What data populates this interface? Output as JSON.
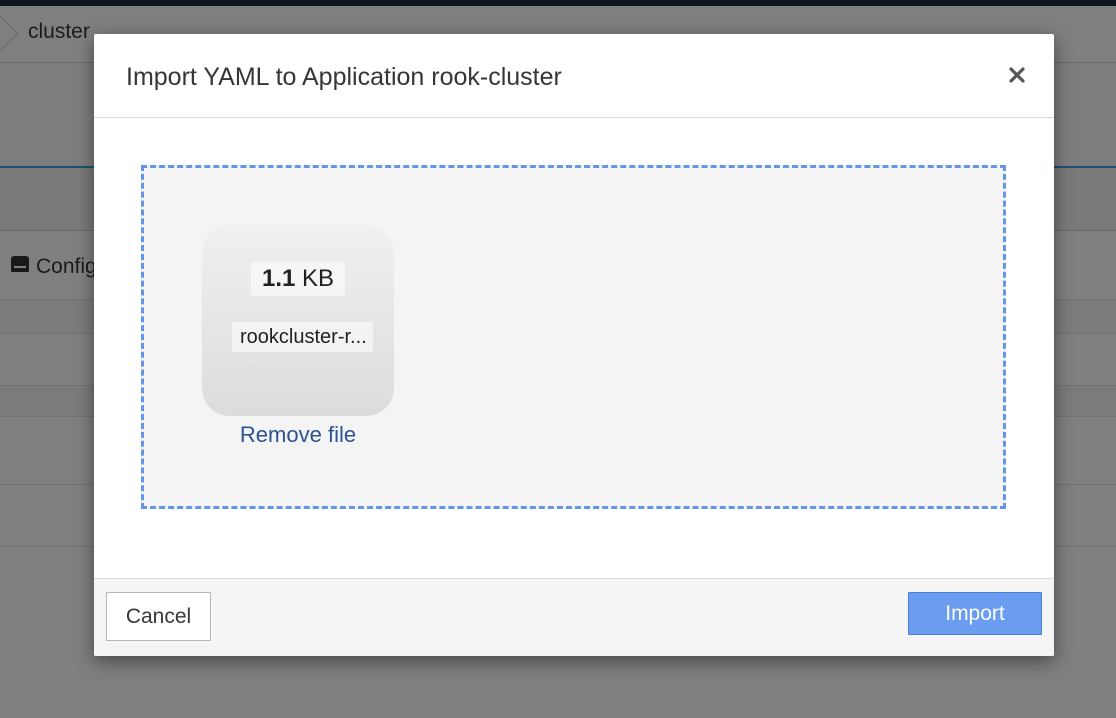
{
  "background_page": {
    "breadcrumb_current": "cluster",
    "tab_label": "Config"
  },
  "modal": {
    "title": "Import YAML to Application rook-cluster",
    "close_icon": "close-icon",
    "dropzone": {
      "file": {
        "size_value": "1.1",
        "size_unit": "KB",
        "name": "rookcluster-r..."
      },
      "remove_label": "Remove file"
    },
    "footer": {
      "cancel_label": "Cancel",
      "import_label": "Import"
    }
  },
  "colors": {
    "dropzone_border": "#6395e8",
    "primary_button": "#6a9cf0",
    "link": "#2c5392",
    "overlay": "rgba(0,0,0,0.5)"
  }
}
